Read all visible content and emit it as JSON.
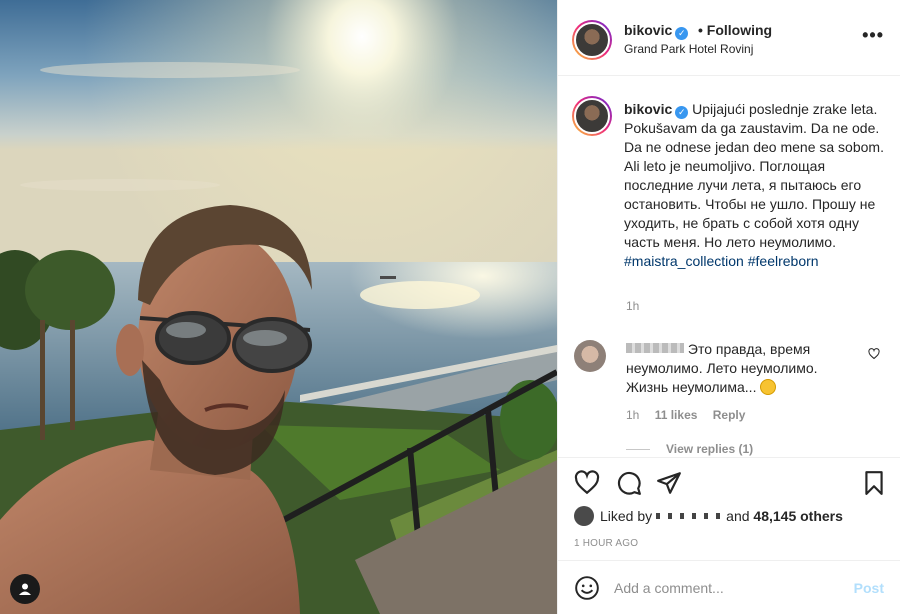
{
  "post": {
    "username": "bikovic",
    "following_label": "• Following",
    "location": "Grand Park Hotel Rovinj",
    "more_icon": "more-options-icon"
  },
  "caption": {
    "username": "bikovic",
    "text": "Upijajući poslednje zrake leta. Pokušavam da ga zaustavim. Da ne ode. Da ne odnese jedan deo mene sa sobom. Ali leto je neumoljivo. Поглощая последние лучи лета, я пытаюсь его остановить. Чтобы не ушло. Прошу не уходить, не брать с собой хотя одну часть меня. Но лето неумолимо.",
    "hashtags": [
      "#maistra_collection",
      "#feelreborn"
    ],
    "time": "1h"
  },
  "comment": {
    "text": "Это правда, время неумолимо. Лето неумолимо. Жизнь неумолима...",
    "time": "1h",
    "likes": "11 likes",
    "reply": "Reply",
    "view_replies": "View replies (1)"
  },
  "likes": {
    "prefix": "Liked by",
    "and": "and",
    "others": "48,145 others"
  },
  "time_ago": "1 HOUR AGO",
  "add_comment": {
    "placeholder": "Add a comment...",
    "post_label": "Post"
  },
  "colors": {
    "link": "#00376b",
    "verified": "#3897f0",
    "post_disabled": "#b2dffc"
  }
}
